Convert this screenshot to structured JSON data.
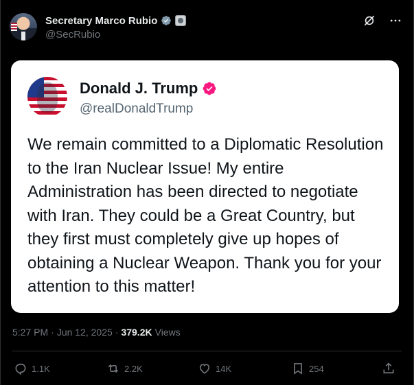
{
  "tweet": {
    "author_name": "Secretary Marco Rubio",
    "author_handle": "@SecRubio",
    "embedded_post": {
      "author_name": "Donald J. Trump",
      "author_handle": "@realDonaldTrump",
      "text": "We remain committed to a Diplomatic Resolution to the Iran Nuclear Issue! My entire Administration has been directed to negotiate with Iran. They could be a Great Country, but they first must completely give up hopes of obtaining a Nuclear Weapon. Thank you for your attention to this matter!"
    },
    "time": "5:27 PM",
    "separator": "·",
    "date": "Jun 12, 2025",
    "separator2": "·",
    "views_count": "379.2K",
    "views_label": "Views"
  },
  "actions": {
    "replies": "1.1K",
    "reposts": "2.2K",
    "likes": "14K",
    "bookmarks": "254"
  },
  "icons": {
    "verified_gray": "verified-badge-icon",
    "government_seal": "government-seal-icon",
    "verified_gold": "verified-badge-icon",
    "grok": "grok-icon",
    "more": "more-icon",
    "reply": "reply-icon",
    "repost": "repost-icon",
    "like": "like-icon",
    "bookmark": "bookmark-icon",
    "share": "share-icon"
  },
  "colors": {
    "background": "#000000",
    "text_primary": "#e7e9ea",
    "text_secondary": "#71767b",
    "card_background": "#ffffff",
    "verified_gray": "#829aab",
    "verified_gold_badge": "#f91880"
  }
}
